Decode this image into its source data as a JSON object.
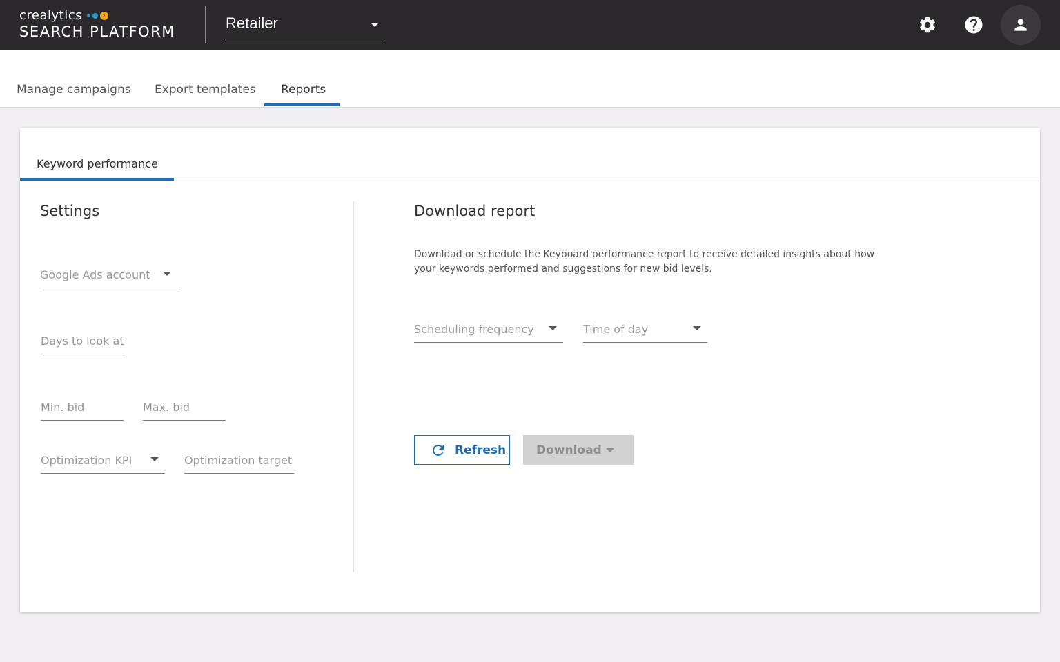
{
  "header": {
    "brand_small": "crealytics",
    "brand_big": "SEARCH PLATFORM",
    "retailer_value": "Retailer",
    "icons": [
      "gear-icon",
      "help-icon",
      "person-icon"
    ],
    "colors": {
      "bar": "#2b292c",
      "accent": "#1e6fb8",
      "dot_blue": "#2a9bd3",
      "dot_orange": "#f5a623"
    }
  },
  "tabs": [
    {
      "label": "Manage campaigns"
    },
    {
      "label": "Export templates"
    },
    {
      "label": "Reports",
      "active": true
    }
  ],
  "card": {
    "subtab": "Keyword performance",
    "settings": {
      "title": "Settings",
      "google_ads_account": "Google Ads account",
      "days": "Days to look at",
      "min_bid": "Min. bid",
      "max_bid": "Max. bid",
      "optimization_kpi": "Optimization KPI",
      "optimization_target": "Optimization target"
    },
    "download": {
      "title": "Download report",
      "description": "Download or schedule the Keyboard performance report to receive detailed insights about how your keywords performed and suggestions for new bid levels.",
      "scheduling_frequency": "Scheduling frequency",
      "time_of_day": "Time of day",
      "refresh_label": "Refresh",
      "download_label": "Download"
    }
  }
}
